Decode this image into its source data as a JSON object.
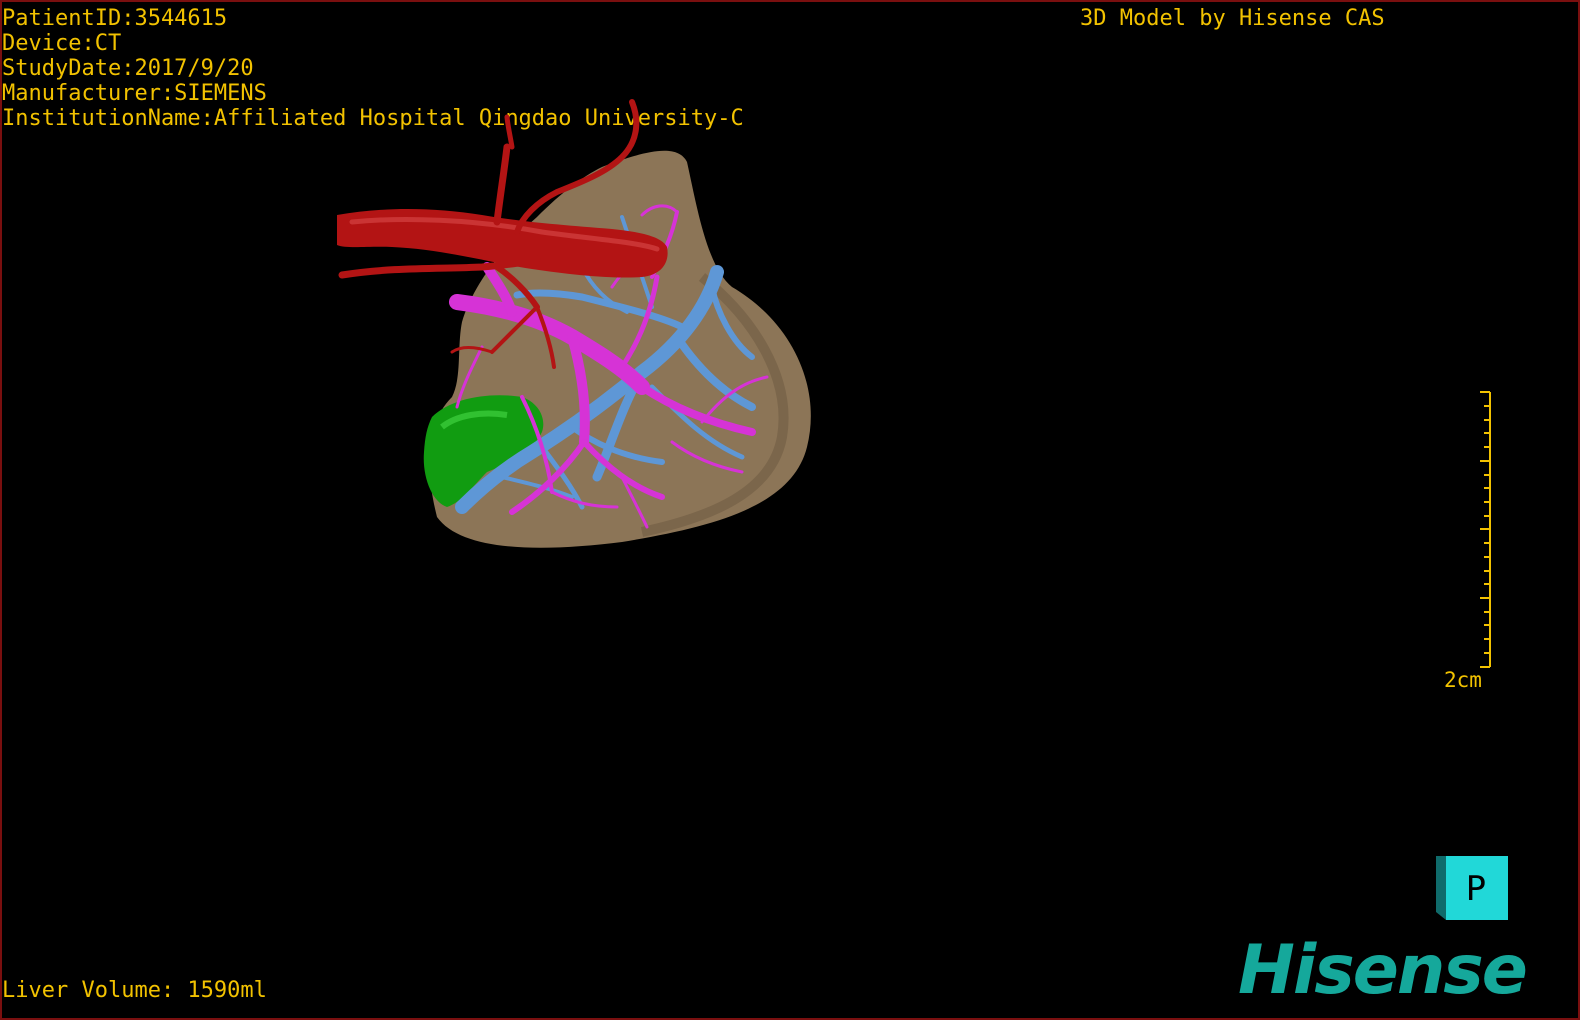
{
  "header": {
    "patient_id": "PatientID:3544615",
    "device": "Device:CT",
    "study_date": "StudyDate:2017/9/20",
    "manufacturer": "Manufacturer:SIEMENS",
    "institution": "InstitutionName:Affiliated Hospital Qingdao University-C",
    "model_credit": "3D Model by Hisense CAS"
  },
  "footer": {
    "liver_volume": "Liver Volume: 1590ml"
  },
  "scale": {
    "label": "2cm"
  },
  "orientation": {
    "label": "P"
  },
  "logo": {
    "text": "Hisense"
  },
  "colors": {
    "overlay_text": "#f2c200",
    "liver": "#8c7557",
    "artery": "#b31414",
    "portal_vein": "#d633d6",
    "hepatic_vein": "#5e97d6",
    "gallbladder": "#119c11",
    "logo": "#15a89b",
    "cube": "#21d8d8"
  }
}
